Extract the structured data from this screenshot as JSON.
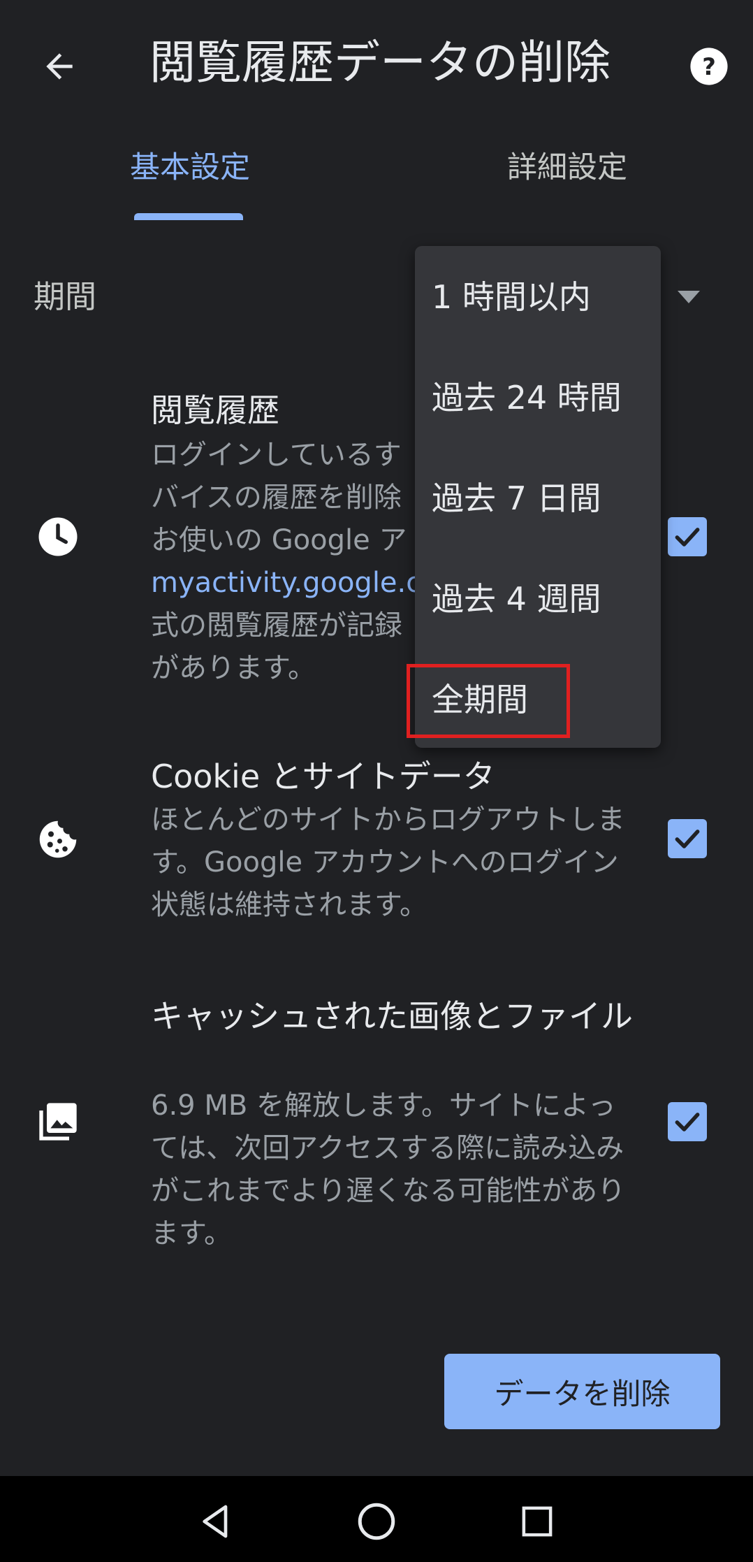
{
  "header": {
    "title": "閲覧履歴データの削除",
    "back_icon": "arrow-back-icon",
    "help_icon": "help-circle-icon"
  },
  "tabs": [
    {
      "label": "基本設定",
      "selected": true
    },
    {
      "label": "詳細設定",
      "selected": false
    }
  ],
  "period": {
    "label": "期間",
    "options": [
      "1 時間以内",
      "過去 24 時間",
      "過去 7 日間",
      "過去 4 週間",
      "全期間"
    ],
    "highlighted_option": "全期間"
  },
  "items": [
    {
      "title": "閲覧履歴",
      "desc_line1": "ログインしているす",
      "desc_line2": "バイスの履歴を削除",
      "desc_line3": "お使いの Google ア",
      "desc_link": "myactivity.google.co",
      "desc_line5": "式の閲覧履歴が記録",
      "desc_line6": "があります。",
      "icon": "clock-icon",
      "checked": true
    },
    {
      "title": "Cookie とサイトデータ",
      "desc": "ほとんどのサイトからログアウトします。Google アカウントへのログイン状態は維持されます。",
      "icon": "cookie-icon",
      "checked": true
    },
    {
      "title": "キャッシュされた画像とファイル",
      "desc": "6.9 MB を解放します。サイトによっては、次回アクセスする際に読み込みがこれまでより遅くなる可能性があります。",
      "icon": "image-stack-icon",
      "checked": true
    }
  ],
  "delete_button": {
    "label": "データを削除"
  },
  "nav": {
    "back_icon": "nav-back-triangle-icon",
    "home_icon": "nav-home-circle-icon",
    "recents_icon": "nav-recents-square-icon"
  },
  "colors": {
    "background": "#202124",
    "accent": "#8ab4f8",
    "menu_bg": "#35363a",
    "highlight": "#e02020"
  }
}
